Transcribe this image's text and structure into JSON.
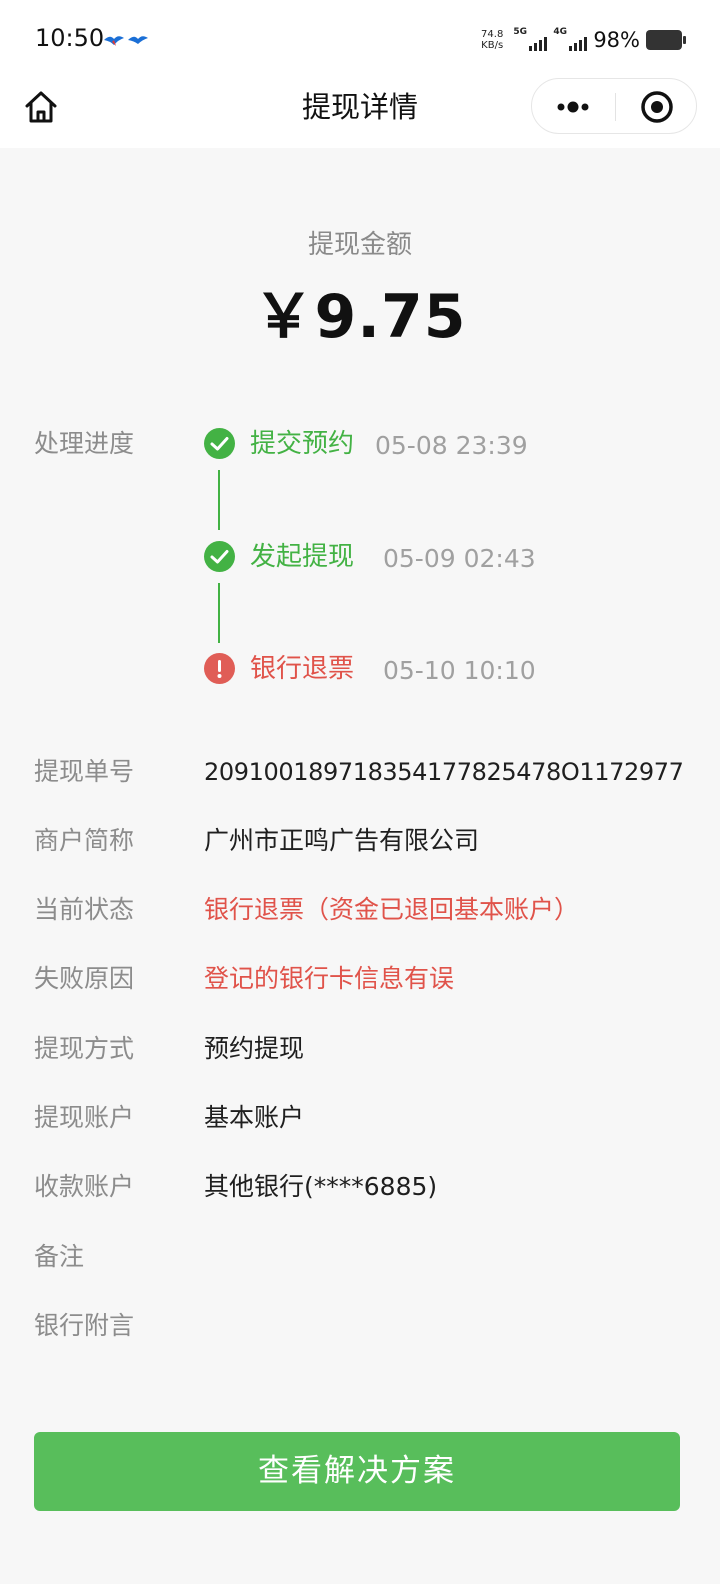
{
  "status_bar": {
    "time": "10:50",
    "net_speed_value": "74.8",
    "net_speed_unit": "KB/s",
    "sim1": "5G",
    "sim2": "4G",
    "battery": "98%"
  },
  "nav": {
    "title": "提现详情",
    "home_icon": "home-icon",
    "more_icon": "more-dots-icon",
    "close_icon": "target-icon"
  },
  "amount": {
    "label": "提现金额",
    "value": "￥9.75"
  },
  "progress": {
    "label": "处理进度",
    "steps": [
      {
        "name": "提交预约",
        "time": "05-08 23:39",
        "status": "done",
        "color": "#43b244"
      },
      {
        "name": "发起提现",
        "time": "05-09 02:43",
        "status": "done",
        "color": "#43b244"
      },
      {
        "name": "银行退票",
        "time": "05-10 10:10",
        "status": "error",
        "color": "#e0534a"
      }
    ]
  },
  "details": [
    {
      "label": "提现单号",
      "value": "209100189718354177825478O1172977"
    },
    {
      "label": "商户简称",
      "value": "广州市正鸣广告有限公司"
    },
    {
      "label": "当前状态",
      "value": "银行退票（资金已退回基本账户）"
    },
    {
      "label": "失败原因",
      "value": "登记的银行卡信息有误"
    },
    {
      "label": "提现方式",
      "value": "预约提现"
    },
    {
      "label": "提现账户",
      "value": "基本账户"
    },
    {
      "label": "收款账户",
      "value": "其他银行(****6885)"
    },
    {
      "label": "备注",
      "value": ""
    },
    {
      "label": "银行附言",
      "value": ""
    }
  ],
  "button": {
    "label": "查看解决方案",
    "color": "#58be5b"
  }
}
